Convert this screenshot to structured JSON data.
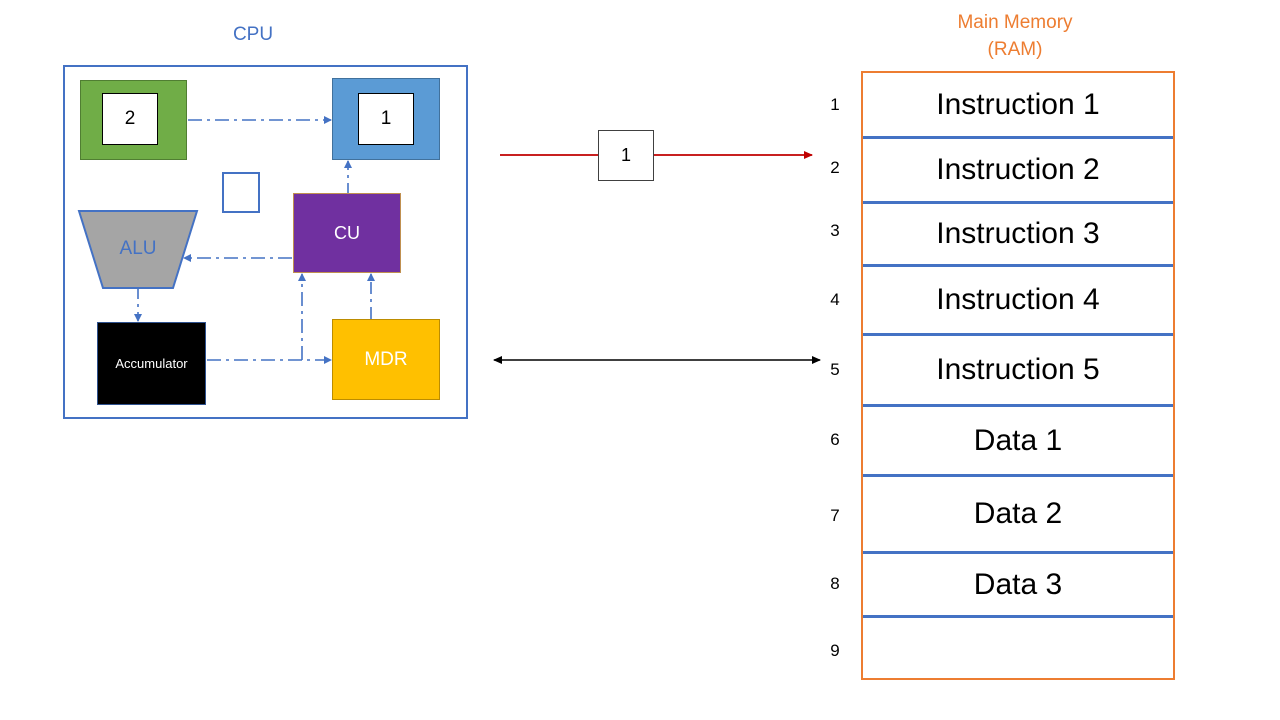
{
  "cpu": {
    "title": "CPU",
    "program_counter": {
      "label": "2",
      "color": "#70ad47"
    },
    "mar": {
      "label": "1",
      "color": "#5b9bd5"
    },
    "alu": {
      "label": "ALU",
      "color": "#a5a5a5"
    },
    "cu": {
      "label": "CU",
      "color": "#7030a0"
    },
    "accumulator": {
      "label": "Accumulator",
      "color": "#000000"
    },
    "mdr": {
      "label": "MDR",
      "color": "#ffc000"
    }
  },
  "buses": {
    "address_bus": {
      "value": "1",
      "color": "#c00000"
    },
    "data_bus": {
      "color": "#000000"
    }
  },
  "memory": {
    "title_line1": "Main Memory",
    "title_line2": "(RAM)",
    "accent": "#ed7d31",
    "rows": [
      {
        "address": "1",
        "content": "Instruction 1"
      },
      {
        "address": "2",
        "content": "Instruction 2"
      },
      {
        "address": "3",
        "content": "Instruction 3"
      },
      {
        "address": "4",
        "content": "Instruction 4"
      },
      {
        "address": "5",
        "content": "Instruction 5"
      },
      {
        "address": "6",
        "content": "Data 1"
      },
      {
        "address": "7",
        "content": "Data 2"
      },
      {
        "address": "8",
        "content": "Data 3"
      },
      {
        "address": "9",
        "content": ""
      }
    ]
  }
}
